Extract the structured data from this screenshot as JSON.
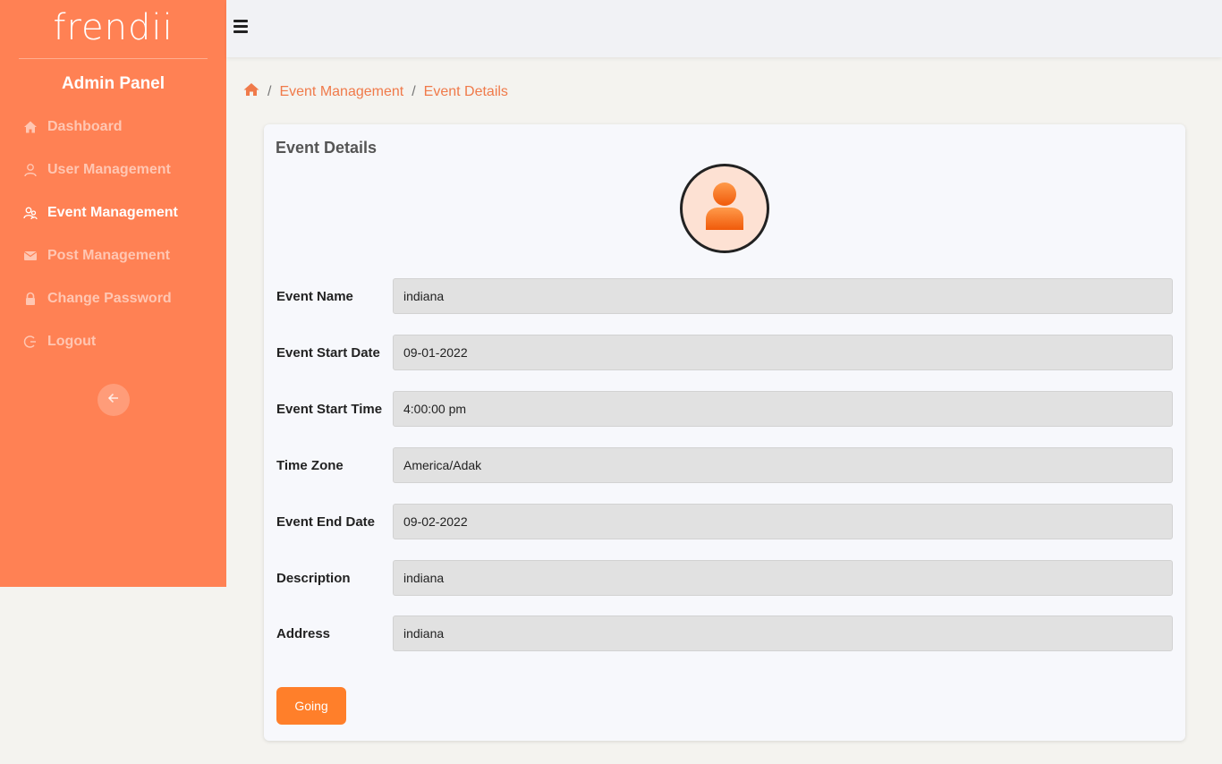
{
  "brand": {
    "logo_text": "frendii",
    "panel_title": "Admin Panel"
  },
  "sidebar": {
    "items": [
      {
        "label": "Dashboard",
        "icon": "home-icon"
      },
      {
        "label": "User Management",
        "icon": "user-icon"
      },
      {
        "label": "Event Management",
        "icon": "users-icon",
        "active": true
      },
      {
        "label": "Post Management",
        "icon": "envelope-icon"
      },
      {
        "label": "Change Password",
        "icon": "lock-icon"
      },
      {
        "label": "Logout",
        "icon": "logout-icon"
      }
    ],
    "collapse_icon": "arrow-left-icon"
  },
  "topbar": {
    "menu_icon": "hamburger-icon"
  },
  "breadcrumb": {
    "home_icon": "home-icon",
    "items": [
      "Event Management",
      "Event Details"
    ],
    "separator": "/"
  },
  "card": {
    "title": "Event Details",
    "avatar_icon": "user-avatar-icon",
    "fields": [
      {
        "label": "Event Name",
        "value": "indiana"
      },
      {
        "label": "Event Start Date",
        "value": "09-01-2022"
      },
      {
        "label": "Event Start Time",
        "value": "4:00:00 pm"
      },
      {
        "label": "Time Zone",
        "value": "America/Adak"
      },
      {
        "label": "Event End Date",
        "value": "09-02-2022"
      },
      {
        "label": "Description",
        "value": "indiana"
      },
      {
        "label": "Address",
        "value": "indiana"
      }
    ],
    "button_label": "Going"
  },
  "colors": {
    "sidebar_bg": "#ff8154",
    "accent": "#f07a4a",
    "button_bg": "#ff7f2a",
    "field_bg": "#e1e1e1"
  }
}
